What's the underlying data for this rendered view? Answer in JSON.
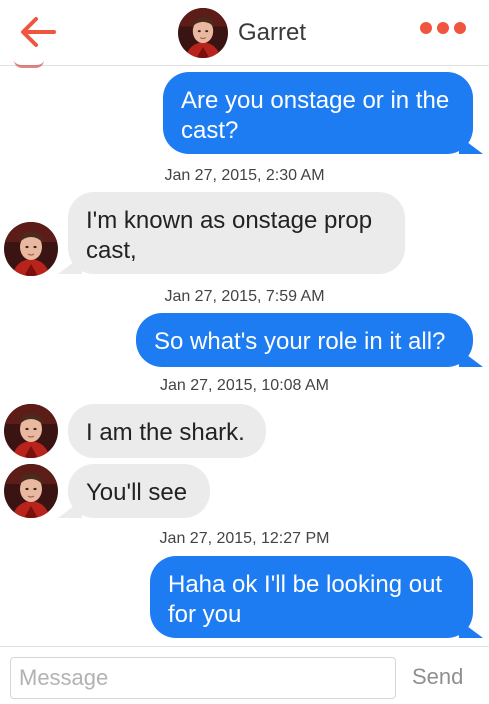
{
  "header": {
    "back_icon": "back-arrow-icon",
    "contact_name": "Garret",
    "more_icon": "more-dots-icon",
    "accent_color": "#f0563f"
  },
  "messages": [
    {
      "direction": "outgoing",
      "text": "Are you onstage or in the cast?"
    },
    {
      "timestamp": "Jan 27, 2015, 2:30 AM"
    },
    {
      "direction": "incoming",
      "text": "I'm known as onstage prop cast,"
    },
    {
      "timestamp": "Jan 27, 2015, 7:59 AM"
    },
    {
      "direction": "outgoing",
      "text": "So what's your role in it all?"
    },
    {
      "timestamp": "Jan 27, 2015, 10:08 AM"
    },
    {
      "direction": "incoming",
      "text": "I am the shark."
    },
    {
      "direction": "incoming",
      "text": "You'll see"
    },
    {
      "timestamp": "Jan 27, 2015, 12:27 PM"
    },
    {
      "direction": "outgoing",
      "text": "Haha ok I'll be looking out for you"
    }
  ],
  "composer": {
    "placeholder": "Message",
    "value": "",
    "send_label": "Send"
  },
  "colors": {
    "outgoing_bubble": "#1e7cf2",
    "incoming_bubble": "#ebebeb"
  }
}
